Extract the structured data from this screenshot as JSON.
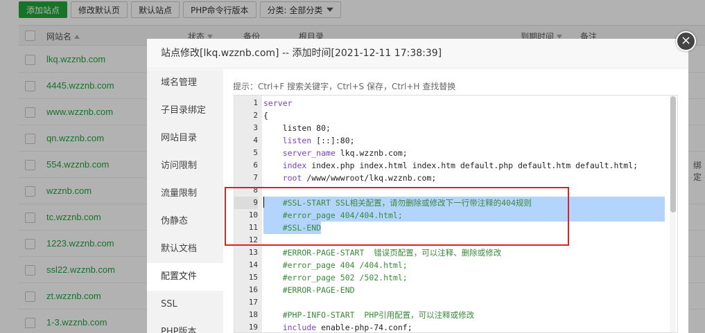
{
  "toolbar": {
    "add_site": "添加站点",
    "edit_default_page": "修改默认页",
    "default_site": "默认站点",
    "php_cli": "PHP命令行版本",
    "category": "分类: 全部分类"
  },
  "table": {
    "headers": {
      "site_name": "网站名",
      "status": "状态",
      "backup": "备份",
      "root": "根目录",
      "expire": "到期时间",
      "note": "备注"
    },
    "rows": [
      "lkq.wzznb.com",
      "4445.wzznb.com",
      "www.wzznb.com",
      "qn.wzznb.com",
      "554.wzznb.com",
      "wzznb.com",
      "tc.wzznb.com",
      "1223.wzznb.com",
      "ssl22.wzznb.com",
      "zt.wzznb.com",
      "1-3.wzznb.com"
    ],
    "partial_text": "绑定"
  },
  "modal": {
    "title": "站点修改[lkq.wzznb.com] -- 添加时间[2021-12-11 17:38:39]",
    "close_glyph": "×",
    "sidebar": [
      "域名管理",
      "子目录绑定",
      "网站目录",
      "访问限制",
      "流量限制",
      "伪静态",
      "默认文档",
      "配置文件",
      "SSL",
      "PHP版本"
    ],
    "active_tab": "配置文件",
    "hint": "提示：Ctrl+F 搜索关键字，Ctrl+S 保存，Ctrl+H 查找替换",
    "editor": {
      "lines": [
        {
          "n": "1",
          "parts": [
            {
              "t": "server",
              "c": "kw"
            }
          ]
        },
        {
          "n": "2",
          "parts": [
            {
              "t": "{",
              "c": "c-black"
            }
          ]
        },
        {
          "n": "3",
          "parts": [
            {
              "t": "    listen 80;",
              "c": "c-black"
            }
          ]
        },
        {
          "n": "4",
          "parts": [
            {
              "t": "    ",
              "c": "c-black"
            },
            {
              "t": "listen",
              "c": "kw"
            },
            {
              "t": " [::]:80;",
              "c": "c-black"
            }
          ]
        },
        {
          "n": "5",
          "parts": [
            {
              "t": "    ",
              "c": "c-black"
            },
            {
              "t": "server_name",
              "c": "kw"
            },
            {
              "t": " lkq.wzznb.com;",
              "c": "c-black"
            }
          ]
        },
        {
          "n": "6",
          "parts": [
            {
              "t": "    ",
              "c": "c-black"
            },
            {
              "t": "index",
              "c": "kw"
            },
            {
              "t": " index.php index.html index.htm default.php default.htm default.html;",
              "c": "c-black"
            }
          ]
        },
        {
          "n": "7",
          "parts": [
            {
              "t": "    ",
              "c": "c-black"
            },
            {
              "t": "root",
              "c": "kw"
            },
            {
              "t": " /www/wwwroot/lkq.wzznb.com;",
              "c": "c-black"
            }
          ]
        },
        {
          "n": "8",
          "parts": [
            {
              "t": "",
              "c": "c-black"
            }
          ]
        },
        {
          "n": "9",
          "parts": [
            {
              "t": "    #SSL-START SSL相关配置，请勿删除或修改下一行带注释的404规则",
              "c": "comment"
            }
          ],
          "sel": true,
          "cur": true
        },
        {
          "n": "10",
          "parts": [
            {
              "t": "    #error_page 404/404.html;",
              "c": "comment"
            }
          ],
          "sel": true
        },
        {
          "n": "11",
          "parts": [
            {
              "t": "    #SSL-END",
              "c": "comment"
            }
          ],
          "selLast": true
        },
        {
          "n": "12",
          "parts": [
            {
              "t": "",
              "c": "c-black"
            }
          ]
        },
        {
          "n": "13",
          "parts": [
            {
              "t": "    #ERROR-PAGE-START  错误页配置，可以注释、删除或修改",
              "c": "comment"
            }
          ]
        },
        {
          "n": "14",
          "parts": [
            {
              "t": "    #error_page 404 /404.html;",
              "c": "comment"
            }
          ]
        },
        {
          "n": "15",
          "parts": [
            {
              "t": "    #error_page 502 /502.html;",
              "c": "comment"
            }
          ]
        },
        {
          "n": "16",
          "parts": [
            {
              "t": "    #ERROR-PAGE-END",
              "c": "comment"
            }
          ]
        },
        {
          "n": "17",
          "parts": [
            {
              "t": "",
              "c": "c-black"
            }
          ]
        },
        {
          "n": "18",
          "parts": [
            {
              "t": "    #PHP-INFO-START  PHP引用配置，可以注释或修改",
              "c": "comment"
            }
          ]
        },
        {
          "n": "19",
          "parts": [
            {
              "t": "    ",
              "c": "c-black"
            },
            {
              "t": "include",
              "c": "kw"
            },
            {
              "t": " enable-php-74.conf;",
              "c": "c-black"
            }
          ]
        }
      ]
    }
  },
  "colors": {
    "accent": "#20a53a",
    "highlight_box": "#e02020",
    "selection": "#b3d4fc"
  }
}
